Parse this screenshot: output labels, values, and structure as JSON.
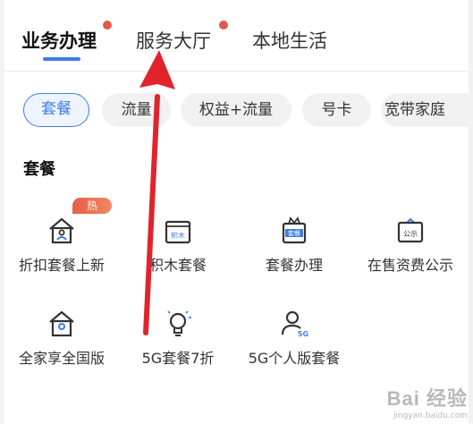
{
  "tabs": [
    {
      "label": "业务办理",
      "active": true,
      "dot": true
    },
    {
      "label": "服务大厅",
      "active": false,
      "dot": true
    },
    {
      "label": "本地生活",
      "active": false,
      "dot": false
    }
  ],
  "chips": [
    {
      "label": "套餐",
      "active": true
    },
    {
      "label": "流量",
      "active": false
    },
    {
      "label": "权益+流量",
      "active": false
    },
    {
      "label": "号卡",
      "active": false
    },
    {
      "label": "宽带家庭",
      "active": false
    }
  ],
  "section": {
    "title": "套餐"
  },
  "grid": {
    "items": [
      {
        "label": "折扣套餐上新",
        "icon": "house-user-icon",
        "badge": "热"
      },
      {
        "label": "积木套餐",
        "icon": "blocks-box-icon",
        "icon_text": "积木"
      },
      {
        "label": "套餐办理",
        "icon": "package-gift-icon",
        "icon_text": "套餐"
      },
      {
        "label": "在售资费公示",
        "icon": "notice-board-icon",
        "icon_text": "公示"
      },
      {
        "label": "全家享全国版",
        "icon": "family-house-icon"
      },
      {
        "label": "5G套餐7折",
        "icon": "lightbulb-icon"
      },
      {
        "label": "5G个人版套餐",
        "icon": "person-5g-icon",
        "icon_text": "5G"
      }
    ]
  },
  "watermark": {
    "brand": "Bai 经验",
    "url": "jingyan.baidu.com"
  },
  "colors": {
    "accent": "#3f7ce6",
    "dot": "#e15a45",
    "arrow": "#e0242c"
  }
}
